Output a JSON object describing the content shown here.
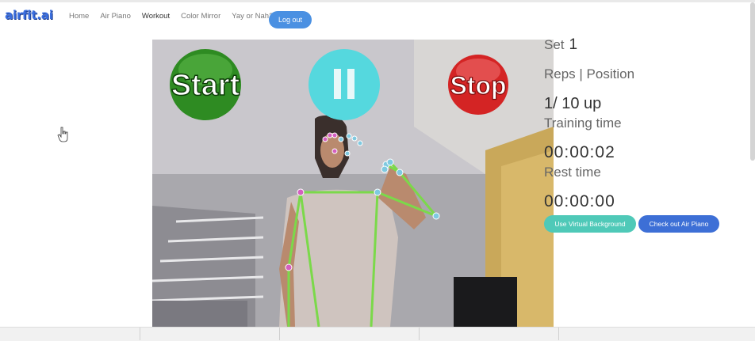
{
  "nav": {
    "brand": "airfit.ai",
    "links": [
      "Home",
      "Air Piano",
      "Workout",
      "Color Mirror",
      "Yay or Nah?"
    ],
    "logout": "Log out"
  },
  "video": {
    "start_label": "Start",
    "stop_label": "Stop",
    "pause_icon": "pause-icon"
  },
  "stats": {
    "set_label": "Set",
    "set_value": "1",
    "reps_label": "Reps | Position",
    "reps_value": "1/ 10 up",
    "training_label": "Training time",
    "training_value": "00:00:02",
    "rest_label": "Rest time",
    "rest_value": "00:00:00"
  },
  "buttons": {
    "virtual_bg": "Use Virtual Background",
    "air_piano": "Check out Air Piano"
  },
  "colors": {
    "start_green": "#2e8b22",
    "pause_cyan": "#55d8de",
    "stop_red": "#d42424",
    "pose_line": "#7bd94a"
  }
}
